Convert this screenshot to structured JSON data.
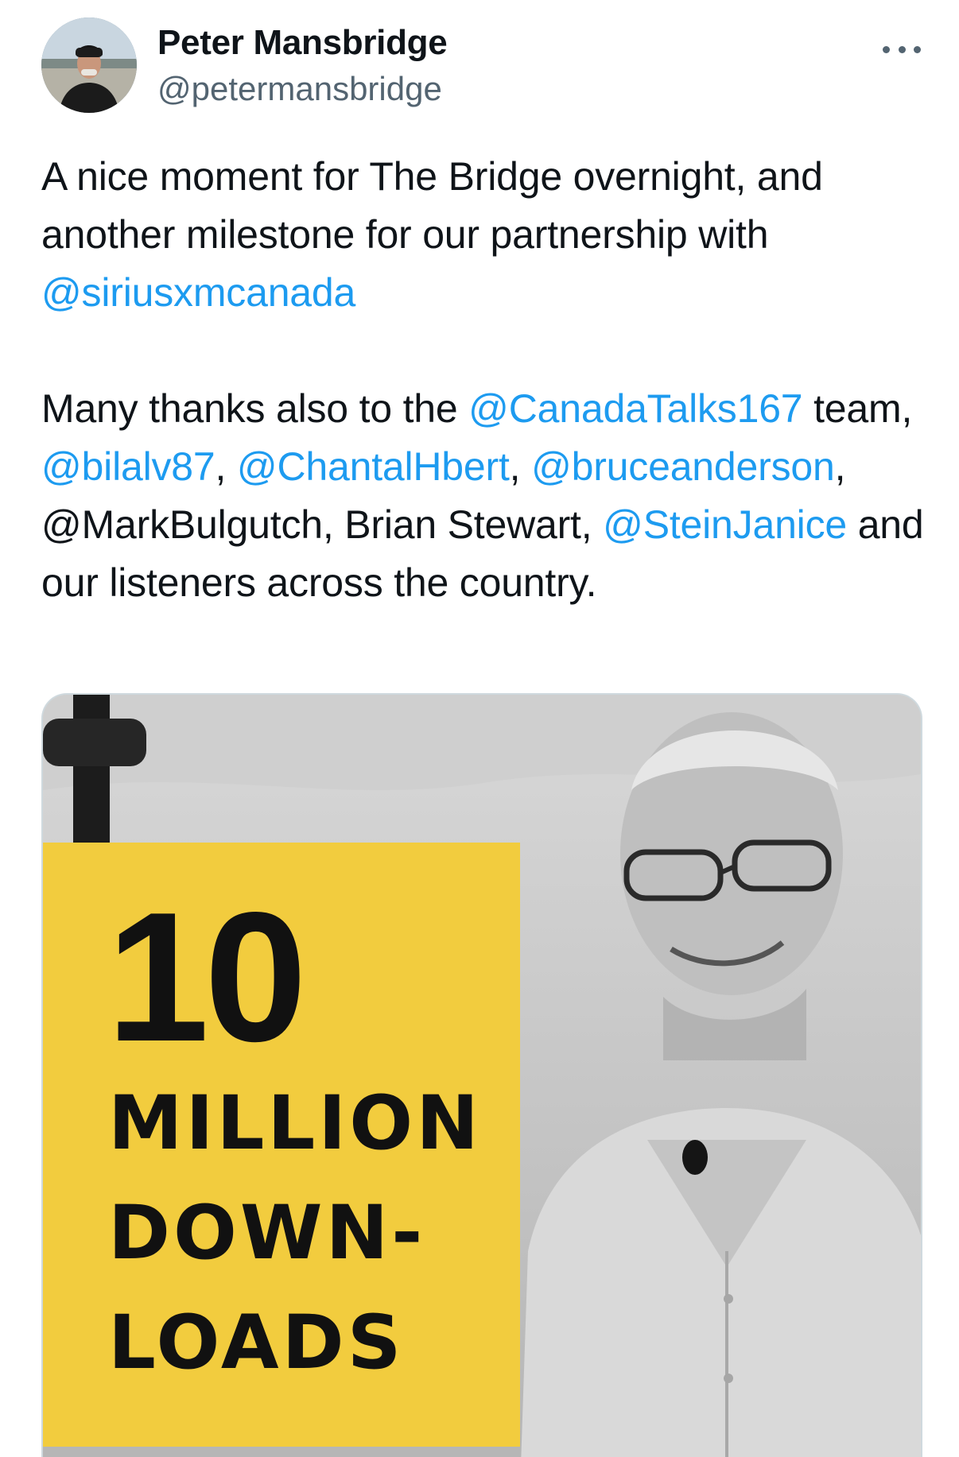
{
  "author": {
    "display_name": "Peter Mansbridge",
    "handle": "@petermansbridge",
    "avatar_icon": "avatar-photo"
  },
  "more_icon": "more-horizontal-icon",
  "tweet": {
    "p1": {
      "t1": "A nice moment for The Bridge overnight, and another milestone for our partnership with",
      "m1": "@siriusxmcanada"
    },
    "p2": {
      "t1": "Many thanks also to the ",
      "m1": "@CanadaTalks167",
      "t2": " team, ",
      "m2": "@bilalv87",
      "t3": ", ",
      "m3": "@ChantalHbert",
      "t4": ", ",
      "m4": "@bruceanderson",
      "t5": ", @MarkBulgutch, Brian Stewart, ",
      "m5": "@SteinJanice",
      "t6": " and our listeners across the country."
    }
  },
  "media": {
    "number": "10",
    "line1": "MILLION",
    "line2": "DOWN-",
    "line3": "LOADS",
    "accent_color": "#f2cc3e",
    "link_color": "#1d9bf0"
  }
}
